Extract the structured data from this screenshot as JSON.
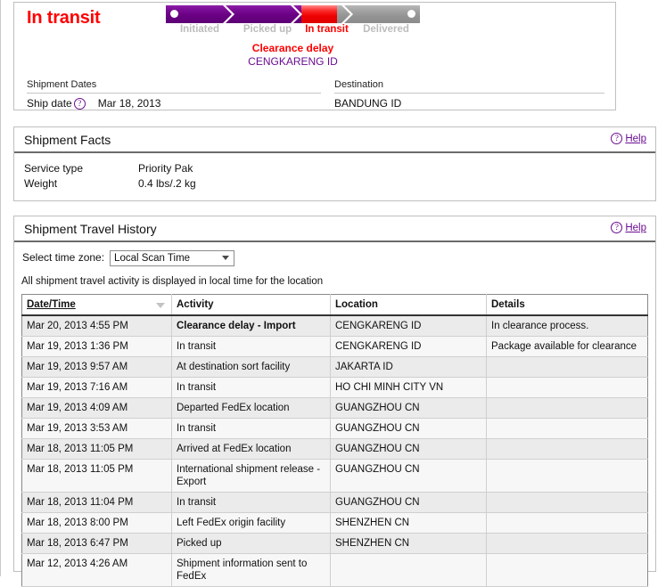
{
  "status": {
    "title": "In transit",
    "title_color": "#ff0000"
  },
  "progress": {
    "steps": [
      {
        "label": "Initiated",
        "state": "complete"
      },
      {
        "label": "Picked up",
        "state": "complete"
      },
      {
        "label": "In transit",
        "state": "current"
      },
      {
        "label": "Delivered",
        "state": "pending"
      }
    ],
    "exception_title": "Clearance delay",
    "exception_location": "CENGKARENG ID",
    "exception_color": "#ff0000",
    "exception_location_color": "#6a0d91",
    "complete_color": "#6a0084",
    "pending_color": "#949494",
    "current_color": "#ee0000"
  },
  "fields": {
    "ship_dates_header": "Shipment Dates",
    "ship_date_label": "Ship date",
    "ship_date_help_icon": "question-circle-icon",
    "ship_date_value": "Mar 18, 2013",
    "destination_header": "Destination",
    "destination_value": "BANDUNG ID"
  },
  "shipment_facts": {
    "title": "Shipment Facts",
    "help_label": "Help",
    "help_icon": "question-circle-icon",
    "rows": [
      {
        "label": "Service type",
        "value": "Priority Pak"
      },
      {
        "label": "Weight",
        "value": "0.4 lbs/.2 kg"
      }
    ]
  },
  "travel_history": {
    "title": "Shipment Travel History",
    "help_label": "Help",
    "help_icon": "question-circle-icon",
    "timezone_label": "Select time zone:",
    "timezone_selected": "Local Scan Time",
    "timezone_options": [
      "Local Scan Time"
    ],
    "note": "All shipment travel activity is displayed in local time for the location",
    "columns": [
      "Date/Time",
      "Activity",
      "Location",
      "Details"
    ],
    "sort_column": "Date/Time",
    "sort_direction": "descending",
    "rows": [
      {
        "datetime": "Mar 20, 2013 4:55 PM",
        "activity": "Clearance delay - Import",
        "location": "CENGKARENG ID",
        "details": "In clearance process."
      },
      {
        "datetime": "Mar 19, 2013 1:36 PM",
        "activity": "In transit",
        "location": "CENGKARENG ID",
        "details": "Package available for clearance"
      },
      {
        "datetime": "Mar 19, 2013 9:57 AM",
        "activity": "At destination sort facility",
        "location": "JAKARTA ID",
        "details": ""
      },
      {
        "datetime": "Mar 19, 2013 7:16 AM",
        "activity": "In transit",
        "location": "HO CHI MINH CITY VN",
        "details": ""
      },
      {
        "datetime": "Mar 19, 2013 4:09 AM",
        "activity": "Departed FedEx location",
        "location": "GUANGZHOU CN",
        "details": ""
      },
      {
        "datetime": "Mar 19, 2013 3:53 AM",
        "activity": "In transit",
        "location": "GUANGZHOU CN",
        "details": ""
      },
      {
        "datetime": "Mar 18, 2013 11:05 PM",
        "activity": "Arrived at FedEx location",
        "location": "GUANGZHOU CN",
        "details": ""
      },
      {
        "datetime": "Mar 18, 2013 11:05 PM",
        "activity": "International shipment release - Export",
        "location": "GUANGZHOU CN",
        "details": ""
      },
      {
        "datetime": "Mar 18, 2013 11:04 PM",
        "activity": "In transit",
        "location": "GUANGZHOU CN",
        "details": ""
      },
      {
        "datetime": "Mar 18, 2013 8:00 PM",
        "activity": "Left FedEx origin facility",
        "location": "SHENZHEN CN",
        "details": ""
      },
      {
        "datetime": "Mar 18, 2013 6:47 PM",
        "activity": "Picked up",
        "location": "SHENZHEN CN",
        "details": ""
      },
      {
        "datetime": "Mar 12, 2013 4:26 AM",
        "activity": "Shipment information sent to FedEx",
        "location": "",
        "details": ""
      }
    ]
  }
}
